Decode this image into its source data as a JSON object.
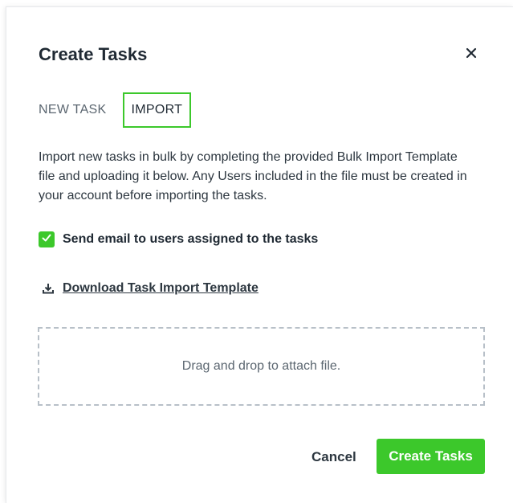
{
  "dialog": {
    "title": "Create Tasks",
    "close_icon": "close-icon"
  },
  "tabs": [
    {
      "label": "NEW TASK",
      "active": false
    },
    {
      "label": "IMPORT",
      "active": true
    }
  ],
  "import": {
    "description": "Import new tasks in bulk by completing the provided Bulk Import Template file and uploading it below. Any Users included in the file must be created in your account before importing the tasks.",
    "send_email": {
      "label": "Send email to users assigned to the tasks",
      "checked": true
    },
    "download": {
      "icon": "download-icon",
      "label": "Download Task Import Template"
    },
    "dropzone": {
      "text": "Drag and drop to attach file."
    }
  },
  "footer": {
    "cancel_label": "Cancel",
    "submit_label": "Create Tasks"
  },
  "colors": {
    "accent": "#3cc82b",
    "text": "#1f2933",
    "muted": "#5b6670",
    "dashed_border": "#b8c0c8"
  }
}
